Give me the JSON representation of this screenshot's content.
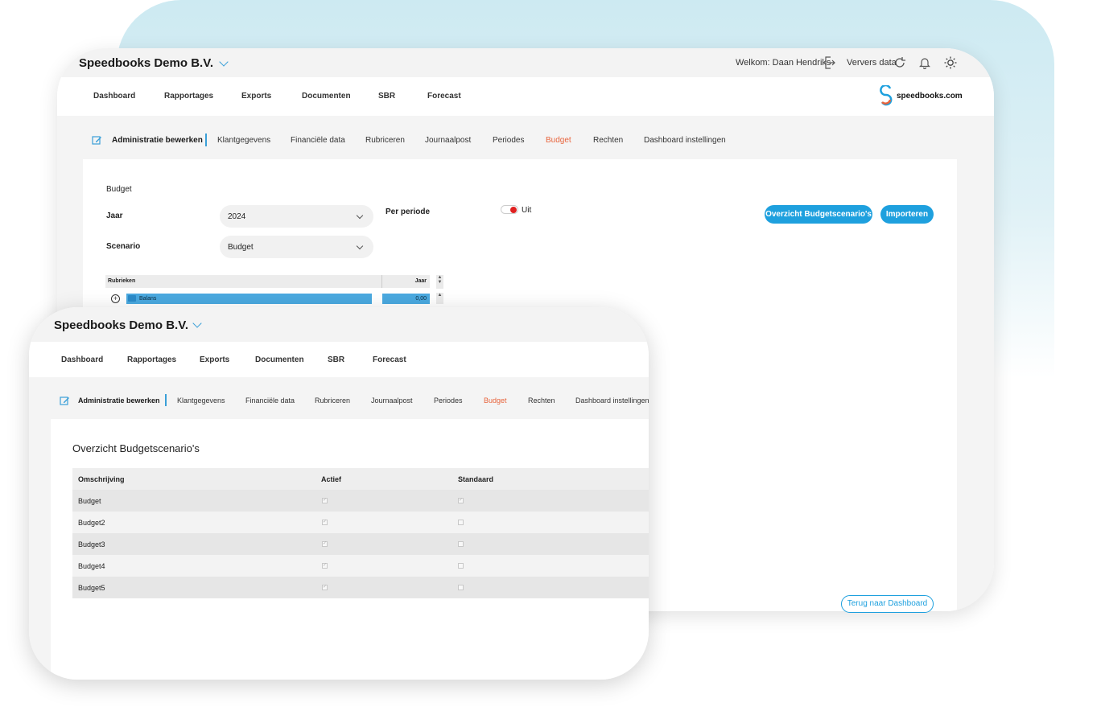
{
  "company": "Speedbooks Demo B.V.",
  "header": {
    "welcome": "Welkom: Daan Hendriks",
    "refresh": "Ververs data"
  },
  "logo": {
    "text": "speedbooks.com"
  },
  "nav": [
    "Dashboard",
    "Rapportages",
    "Exports",
    "Documenten",
    "SBR",
    "Forecast"
  ],
  "subnav": {
    "edit": "Administratie bewerken",
    "items": [
      "Klantgegevens",
      "Financiële data",
      "Rubriceren",
      "Journaalpost",
      "Periodes",
      "Budget",
      "Rechten",
      "Dashboard instellingen"
    ]
  },
  "budget_form": {
    "title": "Budget",
    "year_label": "Jaar",
    "year_value": "2024",
    "scenario_label": "Scenario",
    "scenario_value": "Budget",
    "period_label": "Per periode",
    "toggle_label": "Uit",
    "btn_overview": "Overzicht Budgetscenario's",
    "btn_import": "Importeren",
    "btn_back": "Terug naar Dashboard"
  },
  "tree": {
    "col_rubrieken": "Rubrieken",
    "col_jaar": "Jaar",
    "row_label": "Balans",
    "row_value": "0,00"
  },
  "overview": {
    "title": "Overzicht Budgetscenario's",
    "columns": [
      "Omschrijving",
      "Actief",
      "Standaard"
    ],
    "rows": [
      {
        "name": "Budget",
        "actief": true,
        "standaard": true
      },
      {
        "name": "Budget2",
        "actief": true,
        "standaard": false
      },
      {
        "name": "Budget3",
        "actief": true,
        "standaard": false
      },
      {
        "name": "Budget4",
        "actief": true,
        "standaard": false
      },
      {
        "name": "Budget5",
        "actief": true,
        "standaard": false
      }
    ]
  },
  "colors": {
    "accent": "#1ea0de",
    "active_tab": "#e8643c",
    "toggle_off": "#e02020"
  }
}
